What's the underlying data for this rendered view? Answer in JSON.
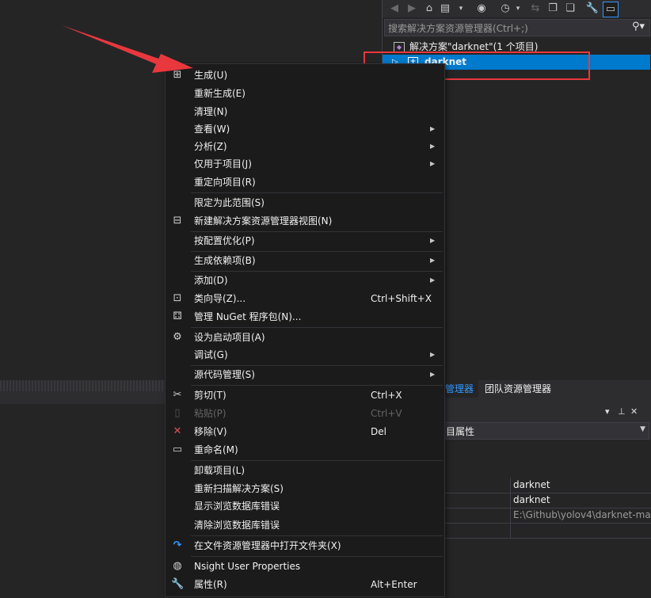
{
  "solution_explorer": {
    "search_placeholder": "搜索解决方案资源管理器(Ctrl+;)",
    "solution_label": "解决方案\"darknet\"(1 个项目)",
    "project_label": "darknet"
  },
  "tabs": {
    "solution_explorer_tab": "管理器",
    "team_explorer_tab": "团队资源管理器"
  },
  "properties": {
    "selector_label": "目属性",
    "rows": [
      {
        "value": "darknet"
      },
      {
        "value": "darknet"
      },
      {
        "value": "E:\\Github\\yolov4\\darknet-ma"
      }
    ]
  },
  "menu": {
    "items": [
      {
        "label": "生成(U)",
        "icon": "build-icon"
      },
      {
        "label": "重新生成(E)"
      },
      {
        "label": "清理(N)"
      },
      {
        "label": "查看(W)",
        "submenu": true
      },
      {
        "label": "分析(Z)",
        "submenu": true
      },
      {
        "label": "仅用于项目(J)",
        "submenu": true
      },
      {
        "label": "重定向项目(R)"
      },
      {
        "label": "限定为此范围(S)"
      },
      {
        "label": "新建解决方案资源管理器视图(N)",
        "icon": "new-view-icon"
      },
      {
        "label": "按配置优化(P)",
        "submenu": true
      },
      {
        "label": "生成依赖项(B)",
        "submenu": true
      },
      {
        "label": "添加(D)",
        "submenu": true
      },
      {
        "label": "类向导(Z)...",
        "shortcut": "Ctrl+Shift+X",
        "icon": "class-wizard-icon"
      },
      {
        "label": "管理 NuGet 程序包(N)...",
        "icon": "nuget-icon"
      },
      {
        "label": "设为启动项目(A)",
        "icon": "gear-icon"
      },
      {
        "label": "调试(G)",
        "submenu": true
      },
      {
        "label": "源代码管理(S)",
        "submenu": true
      },
      {
        "label": "剪切(T)",
        "shortcut": "Ctrl+X",
        "icon": "scissors-icon"
      },
      {
        "label": "粘贴(P)",
        "shortcut": "Ctrl+V",
        "icon": "paste-icon",
        "disabled": true
      },
      {
        "label": "移除(V)",
        "shortcut": "Del",
        "icon": "close-icon"
      },
      {
        "label": "重命名(M)",
        "icon": "rename-icon"
      },
      {
        "label": "卸载项目(L)"
      },
      {
        "label": "重新扫描解决方案(S)"
      },
      {
        "label": "显示浏览数据库错误"
      },
      {
        "label": "清除浏览数据库错误"
      },
      {
        "label": "在文件资源管理器中打开文件夹(X)",
        "icon": "refresh-arrow-icon"
      },
      {
        "label": "Nsight User Properties",
        "icon": "globe-icon"
      },
      {
        "label": "属性(R)",
        "shortcut": "Alt+Enter",
        "icon": "wrench-icon"
      }
    ]
  },
  "colors": {
    "accent": "#007acc",
    "highlight_box": "#e8383d",
    "arrow": "#e8383d",
    "remove_icon": "#e05050"
  }
}
